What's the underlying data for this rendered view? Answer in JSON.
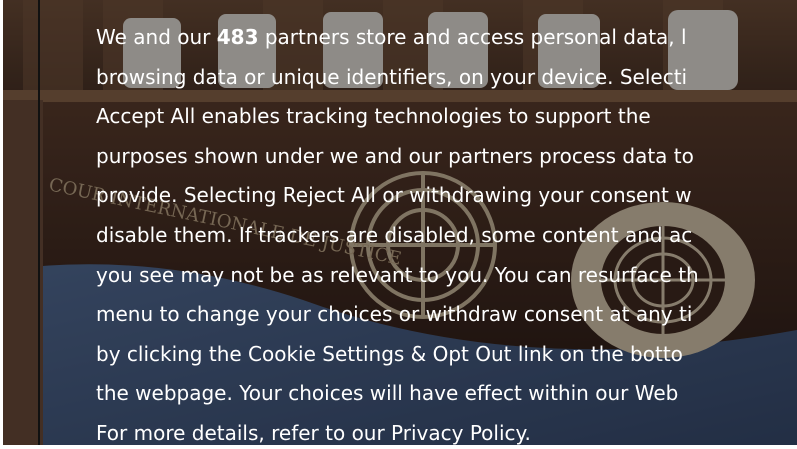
{
  "consent": {
    "line1_pre": "We and our ",
    "partner_count": "483",
    "line1_post": " partners store and access personal data, l",
    "line2": "browsing data or unique identifiers, on your device. Selecti",
    "line3": "Accept All enables tracking technologies to support the",
    "line4": "purposes shown under we and our partners process data to",
    "line5": "provide. Selecting Reject All or withdrawing your consent w",
    "line6": "disable them. If trackers are disabled, some content and ac",
    "line7": "you see may not be as relevant to you. You can resurface th",
    "line8": "menu to change your choices or withdraw consent at any ti",
    "line9": "by clicking the Cookie Settings & Opt Out link on the botto",
    "line10": "the webpage. Your choices will have effect within our Web",
    "line11": "For more details, refer to our Privacy Policy."
  },
  "background_photo": {
    "icon": "courtroom-photo",
    "inscription": "COUR INTERNATIONALE DE JUSTICE",
    "colors": {
      "wall": "#4a3222",
      "bench": "#3b2418",
      "carpet": "#3f5d8a",
      "emblem": "#d8c7a6",
      "chairs": "#f2f0ea",
      "overlay": "rgba(20,15,15,0.45)"
    }
  }
}
